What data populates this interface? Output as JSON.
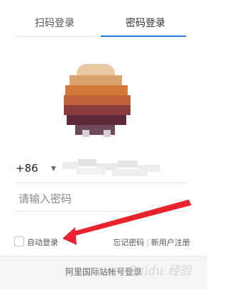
{
  "tabs": [
    {
      "label": "扫码登录"
    },
    {
      "label": "密码登录"
    }
  ],
  "colors": {
    "accent": "#2f7de1",
    "arrow": "#e8232d"
  },
  "phone": {
    "country_code": "+86"
  },
  "password": {
    "placeholder": "请输入密码"
  },
  "auto_login": {
    "label": "自动登录",
    "checked": false
  },
  "links": {
    "forgot": "忘记密码",
    "register": "新用户注册"
  },
  "footer": {
    "link": "阿里国际站帐号登录"
  },
  "watermark": {
    "text": "Baidu 经验"
  },
  "icons": {
    "caret": "caret-down-icon",
    "checkbox": "checkbox-icon",
    "arrow": "annotation-arrow"
  }
}
